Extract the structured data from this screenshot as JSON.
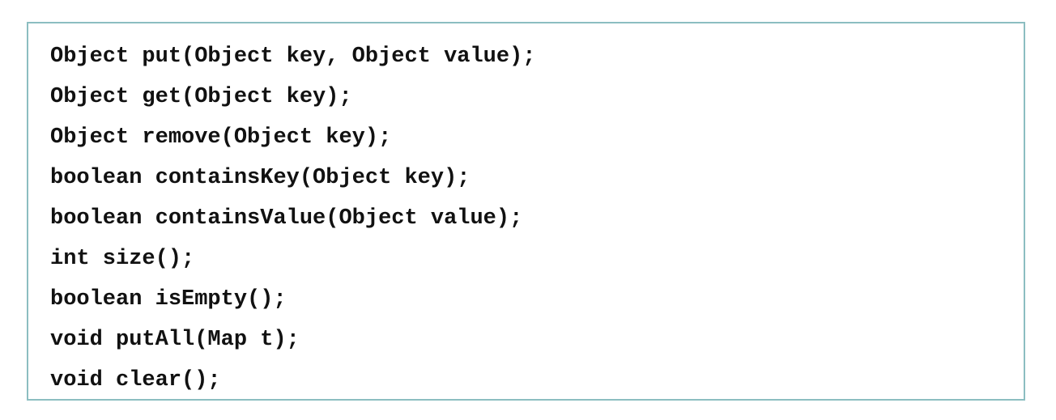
{
  "panel": {
    "name": "java-map-interface-code-block",
    "border_color": "#8cbec1",
    "background_color": "#ffffff",
    "text_color": "#111111"
  },
  "code": {
    "language": "java",
    "lines": [
      "Object put(Object key, Object value);",
      "Object get(Object key);",
      "Object remove(Object key);",
      "boolean containsKey(Object key);",
      "boolean containsValue(Object value);",
      "int size();",
      "boolean isEmpty();",
      "void putAll(Map t);",
      "void clear();"
    ]
  }
}
